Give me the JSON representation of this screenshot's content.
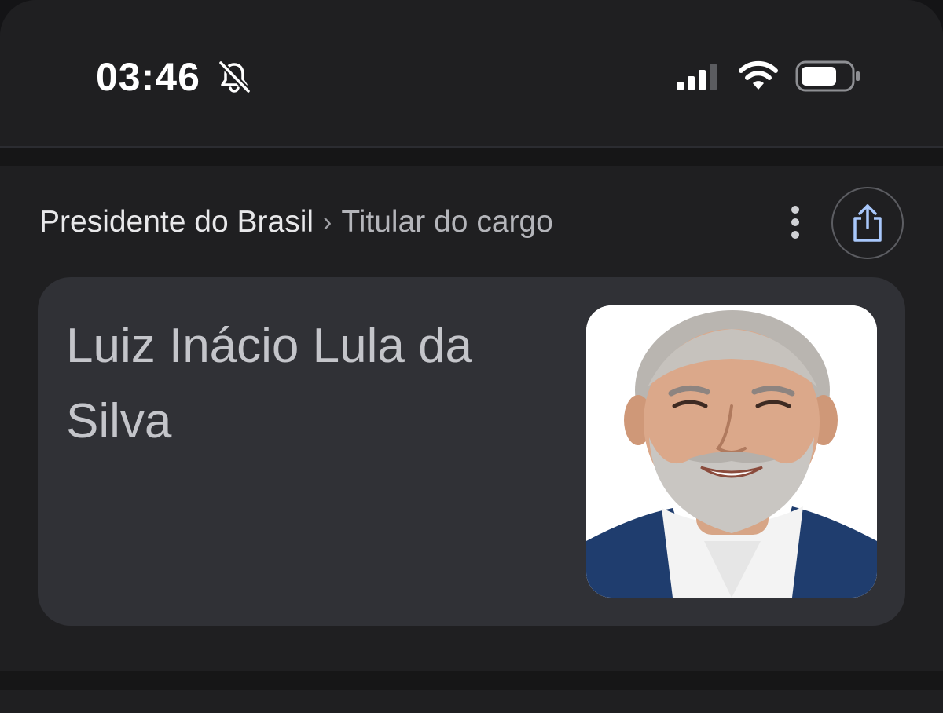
{
  "status_bar": {
    "time": "03:46",
    "silent_icon": "bell-slash-icon",
    "signal_icon": "cellular-signal-icon",
    "wifi_icon": "wifi-icon",
    "battery_icon": "battery-icon"
  },
  "breadcrumb": {
    "primary": "Presidente do Brasil",
    "separator": "›",
    "secondary": "Titular do cargo"
  },
  "actions": {
    "more_icon": "more-vertical-icon",
    "share_icon": "share-icon"
  },
  "card": {
    "name": "Luiz Inácio Lula da Silva",
    "image": "portrait-photo"
  },
  "colors": {
    "background": "#1f1f21",
    "card": "#303136",
    "share_accent": "#a8c7fa"
  }
}
